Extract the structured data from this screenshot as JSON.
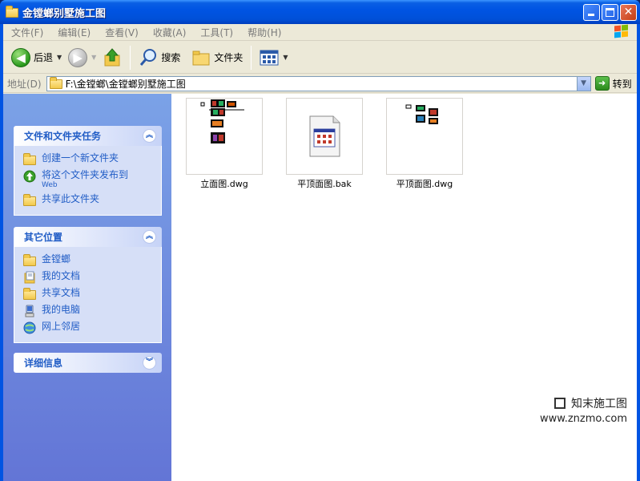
{
  "window": {
    "title": "金镗螂别墅施工图"
  },
  "menu": {
    "items": [
      "文件(F)",
      "编辑(E)",
      "查看(V)",
      "收藏(A)",
      "工具(T)",
      "帮助(H)"
    ]
  },
  "toolbar": {
    "back_label": "后退",
    "search_label": "搜索",
    "folders_label": "文件夹"
  },
  "address": {
    "label": "地址(D)",
    "value": "F:\\金镗螂\\金镗螂别墅施工图",
    "go_label": "转到"
  },
  "tasks_panel": {
    "title": "文件和文件夹任务",
    "items": [
      {
        "label": "创建一个新文件夹",
        "sub": ""
      },
      {
        "label": "将这个文件夹发布到",
        "sub": "Web"
      },
      {
        "label": "共享此文件夹",
        "sub": ""
      }
    ]
  },
  "places_panel": {
    "title": "其它位置",
    "items": [
      {
        "label": "金镗螂",
        "icon": "folder-icon"
      },
      {
        "label": "我的文档",
        "icon": "my-documents-icon"
      },
      {
        "label": "共享文档",
        "icon": "folder-icon"
      },
      {
        "label": "我的电脑",
        "icon": "my-computer-icon"
      },
      {
        "label": "网上邻居",
        "icon": "network-icon"
      }
    ]
  },
  "details_panel": {
    "title": "详细信息"
  },
  "files": [
    {
      "name": "立面图.dwg",
      "thumb": "dwg-thumbnail"
    },
    {
      "name": "平顶面图.bak",
      "thumb": "unknown-file-icon"
    },
    {
      "name": "平顶面图.dwg",
      "thumb": "dwg-thumbnail"
    }
  ],
  "watermark": {
    "cn": "知末施工图",
    "en": "www.znzmo.com"
  },
  "colors": {
    "title_bar": "#0054e3",
    "task_pane": "#7ba2e7",
    "link": "#215dc6"
  }
}
